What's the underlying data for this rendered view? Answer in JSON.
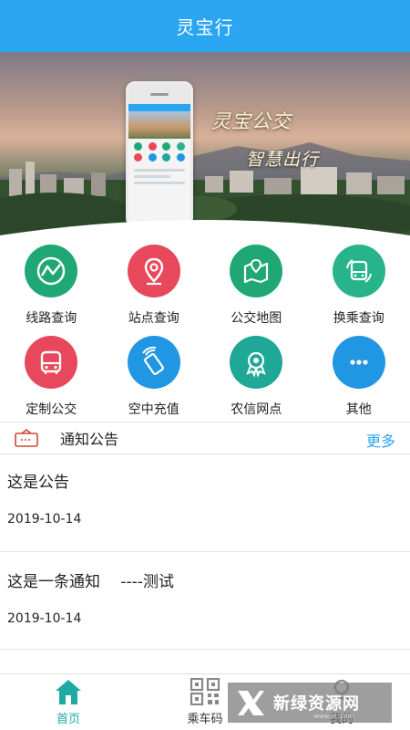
{
  "header": {
    "title": "灵宝行"
  },
  "banner": {
    "caption1": "灵宝公交",
    "caption2": "智慧出行"
  },
  "entries": [
    {
      "label": "线路查询",
      "icon": "route-icon",
      "color": "#1fa876"
    },
    {
      "label": "站点查询",
      "icon": "location-pin-icon",
      "color": "#e8485b"
    },
    {
      "label": "公交地图",
      "icon": "map-icon",
      "color": "#1fa876"
    },
    {
      "label": "换乘查询",
      "icon": "bus-transfer-icon",
      "color": "#27b48a"
    },
    {
      "label": "定制公交",
      "icon": "bus-icon",
      "color": "#e8485b"
    },
    {
      "label": "空中充值",
      "icon": "phone-recharge-icon",
      "color": "#2196e3"
    },
    {
      "label": "农信网点",
      "icon": "badge-icon",
      "color": "#1fa896"
    },
    {
      "label": "其他",
      "icon": "more-icon",
      "color": "#2196e3"
    }
  ],
  "notice": {
    "title": "通知公告",
    "more": "更多",
    "items": [
      {
        "title": "这是公告",
        "date": "2019-10-14"
      },
      {
        "title": "这是一条通知　 ----测试",
        "date": "2019-10-14"
      }
    ]
  },
  "tabs": [
    {
      "label": "首页",
      "icon": "home-icon",
      "active": true
    },
    {
      "label": "乘车码",
      "icon": "qr-code-icon",
      "active": false
    },
    {
      "label": "我的",
      "icon": "profile-icon",
      "active": false
    }
  ],
  "watermark": {
    "text": "新绿资源网",
    "sub": "www.xl..com"
  },
  "colors": {
    "primary": "#2aa5f2",
    "active_tab": "#1fa9a3"
  }
}
